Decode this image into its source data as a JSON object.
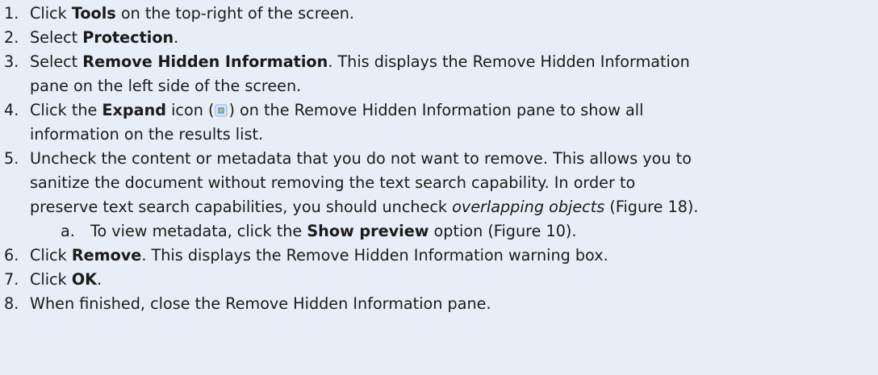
{
  "steps": [
    {
      "num": "1.",
      "lines": [
        [
          "Click ",
          {
            "b": "Tools"
          },
          " on the top-right of the screen."
        ]
      ]
    },
    {
      "num": "2.",
      "lines": [
        [
          "Select ",
          {
            "b": "Protection"
          },
          "."
        ]
      ]
    },
    {
      "num": "3.",
      "lines": [
        [
          "Select ",
          {
            "b": "Remove Hidden Information"
          },
          ".  This displays the Remove Hidden Information"
        ],
        [
          "pane on the left side of the screen."
        ]
      ]
    },
    {
      "num": "4.",
      "lines": [
        [
          "Click the ",
          {
            "b": "Expand"
          },
          " icon (",
          {
            "icon": "expand-icon"
          },
          ") on the Remove Hidden Information pane to show all"
        ],
        [
          "information on the results list."
        ]
      ]
    },
    {
      "num": "5.",
      "lines": [
        [
          "Uncheck the content or metadata that you do not want to remove.  This allows you to"
        ],
        [
          "sanitize the document without removing the text search capability.  In order to"
        ],
        [
          "preserve text search capabilities, you should uncheck ",
          {
            "i": "overlapping objects"
          },
          " (Figure 18)."
        ]
      ],
      "sub": {
        "num": "a.",
        "lines": [
          [
            "To view metadata, click the ",
            {
              "b": "Show preview"
            },
            " option (Figure 10)."
          ]
        ]
      }
    },
    {
      "num": "6.",
      "lines": [
        [
          "Click ",
          {
            "b": "Remove"
          },
          ".  This displays the Remove Hidden Information warning box."
        ]
      ]
    },
    {
      "num": "7.",
      "lines": [
        [
          "Click ",
          {
            "b": "OK"
          },
          "."
        ]
      ]
    },
    {
      "num": "8.",
      "lines": [
        [
          "When finished, close the Remove Hidden Information pane."
        ]
      ]
    }
  ]
}
